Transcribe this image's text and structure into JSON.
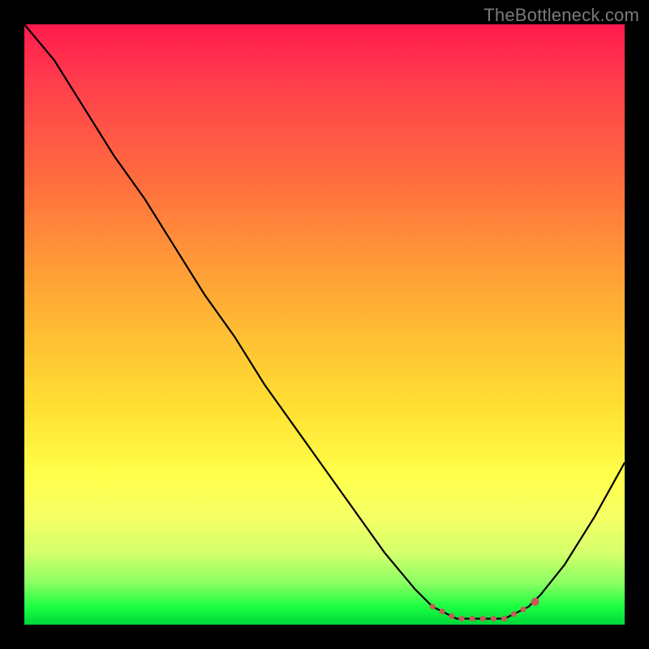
{
  "watermark": "TheBottleneck.com",
  "chart_data": {
    "type": "line",
    "title": "",
    "xlabel": "",
    "ylabel": "",
    "x": [
      0.0,
      0.05,
      0.1,
      0.15,
      0.2,
      0.25,
      0.3,
      0.35,
      0.4,
      0.45,
      0.5,
      0.55,
      0.6,
      0.65,
      0.68,
      0.7,
      0.72,
      0.74,
      0.76,
      0.78,
      0.8,
      0.82,
      0.84,
      0.86,
      0.9,
      0.95,
      1.0
    ],
    "y": [
      1.0,
      0.94,
      0.86,
      0.78,
      0.71,
      0.63,
      0.55,
      0.48,
      0.4,
      0.33,
      0.26,
      0.19,
      0.12,
      0.06,
      0.03,
      0.02,
      0.01,
      0.01,
      0.01,
      0.01,
      0.01,
      0.02,
      0.03,
      0.05,
      0.1,
      0.18,
      0.27
    ],
    "ylim": [
      0,
      1
    ],
    "xlim": [
      0,
      1
    ],
    "annotation": "plateau-dotted-markers",
    "plateau_x_range": [
      0.66,
      0.84
    ],
    "colors": {
      "line": "#000000",
      "markers": "#c65a5a"
    }
  }
}
